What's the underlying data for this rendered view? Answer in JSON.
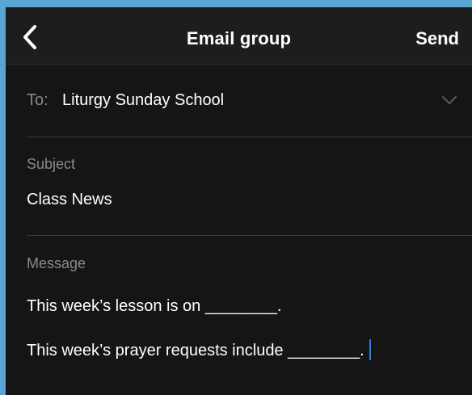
{
  "header": {
    "title": "Email group",
    "send_label": "Send",
    "back_icon": "chevron-left-icon"
  },
  "to": {
    "label": "To:",
    "value": "Liturgy Sunday School",
    "dropdown_icon": "chevron-down-icon"
  },
  "subject": {
    "label": "Subject",
    "value": "Class News"
  },
  "message": {
    "label": "Message",
    "lines": [
      "This week’s lesson is on ________.",
      "This week’s prayer requests include ________."
    ]
  },
  "colors": {
    "background": "#151515",
    "navbar": "#1d1d1d",
    "divider": "#3a3a3a",
    "label_gray": "#8a8a8a",
    "text": "#ffffff",
    "caret": "#2f7fd8",
    "outer_border": "#5aa5d3"
  }
}
